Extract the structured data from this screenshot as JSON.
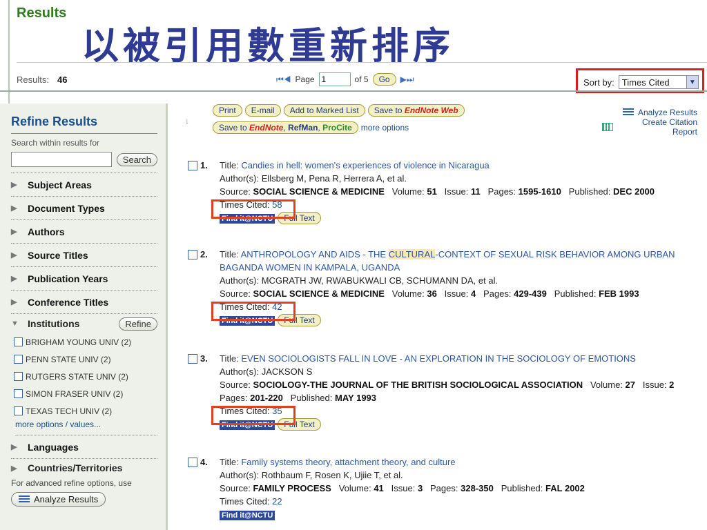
{
  "header": {
    "results_heading": "Results",
    "overlay_title": "以被引用數重新排序",
    "results_label": "Results:",
    "results_count": "46"
  },
  "pager": {
    "page_label": "Page",
    "page_value": "1",
    "of_label": "of 5",
    "go_label": "Go"
  },
  "sort": {
    "label": "Sort by:",
    "selected": "Times Cited"
  },
  "toolbar": {
    "print": "Print",
    "email": "E-mail",
    "marked_list": "Add to Marked List",
    "save_to": "Save to",
    "endnote_web": "EndNote Web",
    "save_to2": "Save to",
    "endnote": "EndNote",
    "refman": "RefMan",
    "procite": "ProCite",
    "more_options": "more options",
    "analyze_results": "Analyze Results",
    "citation_report": "Create Citation Report"
  },
  "sidebar": {
    "refine_title": "Refine Results",
    "search_label": "Search within results for",
    "search_button": "Search",
    "facets": [
      "Subject Areas",
      "Document Types",
      "Authors",
      "Source Titles",
      "Publication Years",
      "Conference Titles"
    ],
    "institutions_label": "Institutions",
    "refine_button": "Refine",
    "institutions": [
      "BRIGHAM YOUNG UNIV (2)",
      "PENN STATE UNIV (2)",
      "RUTGERS STATE UNIV (2)",
      "SIMON FRASER UNIV (2)",
      "TEXAS TECH UNIV (2)"
    ],
    "more_values": "more options / values...",
    "languages": "Languages",
    "countries": "Countries/Territories",
    "advanced_text": "For advanced refine options, use",
    "analyze_button": "Analyze Results"
  },
  "labels": {
    "title": "Title:",
    "authors": "Author(s):",
    "source": "Source:",
    "volume": "Volume:",
    "issue": "Issue:",
    "pages": "Pages:",
    "published": "Published:",
    "times_cited": "Times Cited:",
    "findit": "Find it@NCTU",
    "fulltext": "Full Text"
  },
  "records": [
    {
      "num": "1.",
      "title": "Candies in hell: women's experiences of violence in Nicaragua",
      "authors": "Ellsberg M, Pena R, Herrera A, et al.",
      "source": "SOCIAL SCIENCE & MEDICINE",
      "volume": "51",
      "issue": "11",
      "pages": "1595-1610",
      "published": "DEC 2000",
      "cited": "58"
    },
    {
      "num": "2.",
      "title_a": "ANTHROPOLOGY AND AIDS - THE ",
      "title_hl": "CULTURAL",
      "title_b": "-CONTEXT OF SEXUAL RISK BEHAVIOR AMONG URBAN BAGANDA WOMEN IN KAMPALA, UGANDA",
      "authors": "MCGRATH JW, RWABUKWALI CB, SCHUMANN DA, et al.",
      "source": "SOCIAL SCIENCE & MEDICINE",
      "volume": "36",
      "issue": "4",
      "pages": "429-439",
      "published": "FEB 1993",
      "cited": "42"
    },
    {
      "num": "3.",
      "title": "EVEN SOCIOLOGISTS FALL IN LOVE - AN EXPLORATION IN THE SOCIOLOGY OF EMOTIONS",
      "authors": "JACKSON S",
      "source": "SOCIOLOGY-THE JOURNAL OF THE BRITISH SOCIOLOGICAL ASSOCIATION",
      "volume": "27",
      "issue": "2",
      "pages": "201-220",
      "published": "MAY 1993",
      "cited": "35"
    },
    {
      "num": "4.",
      "title": "Family systems theory, attachment theory, and culture",
      "authors": "Rothbaum F, Rosen K, Ujiie T, et al.",
      "source": "FAMILY PROCESS",
      "volume": "41",
      "issue": "3",
      "pages": "328-350",
      "published": "FAL 2002",
      "cited": "22"
    }
  ]
}
